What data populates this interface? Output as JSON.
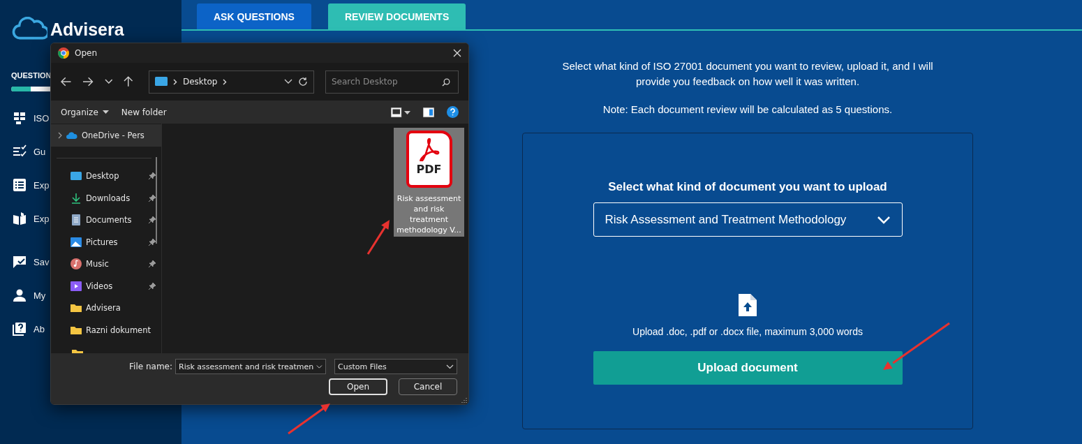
{
  "logo": {
    "name": "Advisera"
  },
  "sidebar": {
    "heading": "QUESTION",
    "progress": {
      "level": 0.35
    },
    "items": [
      {
        "label": "ISO"
      },
      {
        "label": "Gu"
      },
      {
        "label": "Exp"
      },
      {
        "label": "Exp"
      },
      {
        "label": "Sav"
      },
      {
        "label": "My"
      },
      {
        "label": "Ab"
      }
    ]
  },
  "tabs": [
    {
      "label": "ASK QUESTIONS",
      "selected": false
    },
    {
      "label": "REVIEW DOCUMENTS",
      "selected": true
    }
  ],
  "intro": "Select what kind of ISO 27001 document you want to review, upload it, and I will provide you feedback on how well it was written.",
  "note": "Note: Each document review will be calculated as 5 questions.",
  "upload_card": {
    "heading": "Select what kind of document you want to upload",
    "document_type": "Risk Assessment and Treatment Methodology",
    "hint": "Upload .doc, .pdf or .docx file, maximum 3,000 words",
    "button": "Upload document"
  },
  "dialog": {
    "title": "Open",
    "path": "Desktop",
    "search": {
      "placeholder": "Search Desktop"
    },
    "toolbar": [
      "Organize",
      "New folder"
    ],
    "nav": [
      {
        "label": "OneDrive - Pers",
        "kind": "cloud",
        "pinned": false,
        "selected": true
      },
      {
        "label": "Desktop",
        "kind": "desktop",
        "pinned": true,
        "selected": false
      },
      {
        "label": "Downloads",
        "kind": "downloads",
        "pinned": true,
        "selected": false
      },
      {
        "label": "Documents",
        "kind": "documents",
        "pinned": true,
        "selected": false
      },
      {
        "label": "Pictures",
        "kind": "pictures",
        "pinned": true,
        "selected": false
      },
      {
        "label": "Music",
        "kind": "music",
        "pinned": true,
        "selected": false
      },
      {
        "label": "Videos",
        "kind": "videos",
        "pinned": true,
        "selected": false
      },
      {
        "label": "Advisera",
        "kind": "folder",
        "pinned": false,
        "selected": false
      },
      {
        "label": "Razni dokument",
        "kind": "folder",
        "pinned": false,
        "selected": false
      }
    ],
    "files": [
      {
        "badge": "PDF",
        "name": "Risk assessment and risk treatment methodology V...",
        "selected": true
      }
    ],
    "file_name_label": "File name:",
    "file_name": "Risk assessment and risk treatmen",
    "file_type": "Custom Files",
    "buttons": [
      "Open",
      "Cancel"
    ]
  }
}
